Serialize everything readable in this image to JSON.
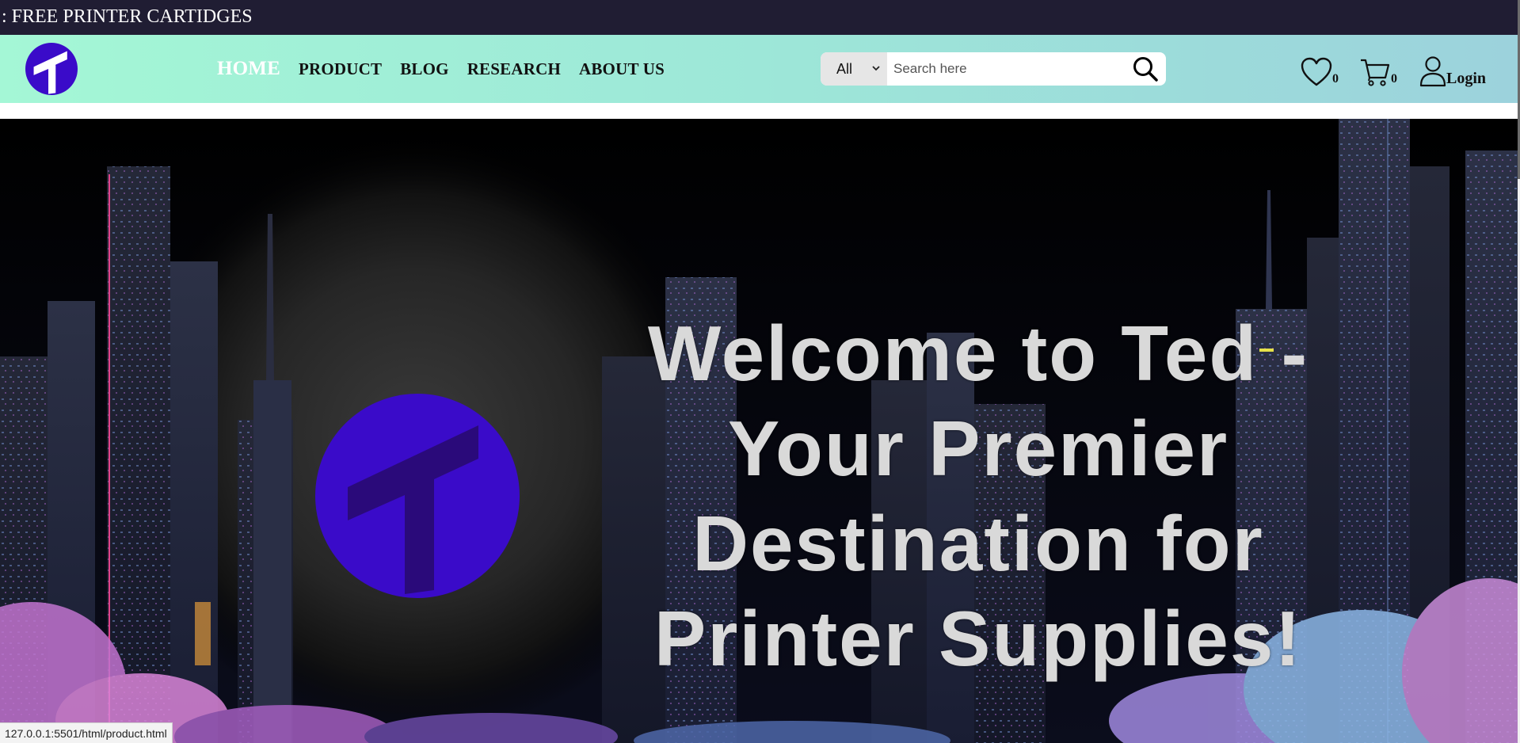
{
  "announcement": {
    "text": ": FREE PRINTER CARTIDGES"
  },
  "header": {
    "logo_icon": "ted-logo-icon",
    "nav": [
      {
        "label": "HOME",
        "active": true
      },
      {
        "label": "PRODUCT",
        "active": false
      },
      {
        "label": "BLOG",
        "active": false
      },
      {
        "label": "RESEARCH",
        "active": false
      },
      {
        "label": "ABOUT US",
        "active": false
      }
    ],
    "search": {
      "category": "All",
      "placeholder": "Search here",
      "value": "",
      "icon": "search-icon"
    },
    "wishlist": {
      "icon": "heart-icon",
      "count": "0"
    },
    "cart": {
      "icon": "cart-icon",
      "count": "0"
    },
    "account": {
      "icon": "user-icon",
      "label": "Login"
    }
  },
  "hero": {
    "title_lines": [
      "Welcome to Ted -",
      "Your Premier",
      "Destination for",
      "Printer Supplies!"
    ],
    "logo_icon": "ted-logo-icon"
  },
  "browser": {
    "status_url": "127.0.0.1:5501/html/product.html"
  },
  "colors": {
    "announce_bg": "#201d33",
    "header_gradient_start": "#a4f7d6",
    "header_gradient_end": "#9cd2dc",
    "logo_purple": "#3a0bc9",
    "hero_text": "#d9d9d9"
  }
}
